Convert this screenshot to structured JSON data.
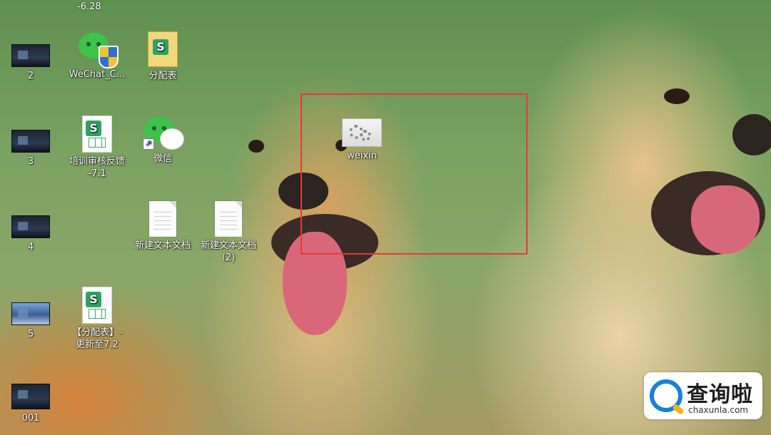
{
  "desktop": {
    "top_fragment": "-6.28",
    "icons": [
      {
        "id": "thumb-2",
        "label": "2"
      },
      {
        "id": "wechat-installer",
        "label": "WeChat_C..."
      },
      {
        "id": "fenpeibiao-folder",
        "label": "分配表"
      },
      {
        "id": "thumb-3",
        "label": "3"
      },
      {
        "id": "training-review",
        "label": "培训审核反馈\n-7.1"
      },
      {
        "id": "weixin-shortcut",
        "label": "微信"
      },
      {
        "id": "weixin-app",
        "label": "weixin"
      },
      {
        "id": "thumb-4",
        "label": "4"
      },
      {
        "id": "new-text-1",
        "label": "新建文本文档"
      },
      {
        "id": "new-text-2",
        "label": "新建文本文档\n(2)"
      },
      {
        "id": "thumb-5",
        "label": "5"
      },
      {
        "id": "fenpeibiao-update",
        "label": "【分配表】-\n更新至7.2"
      },
      {
        "id": "thumb-001",
        "label": "001"
      }
    ]
  },
  "highlight": {
    "color": "#e53b35"
  },
  "watermark": {
    "title": "查询啦",
    "url": "chaxunla.com"
  }
}
